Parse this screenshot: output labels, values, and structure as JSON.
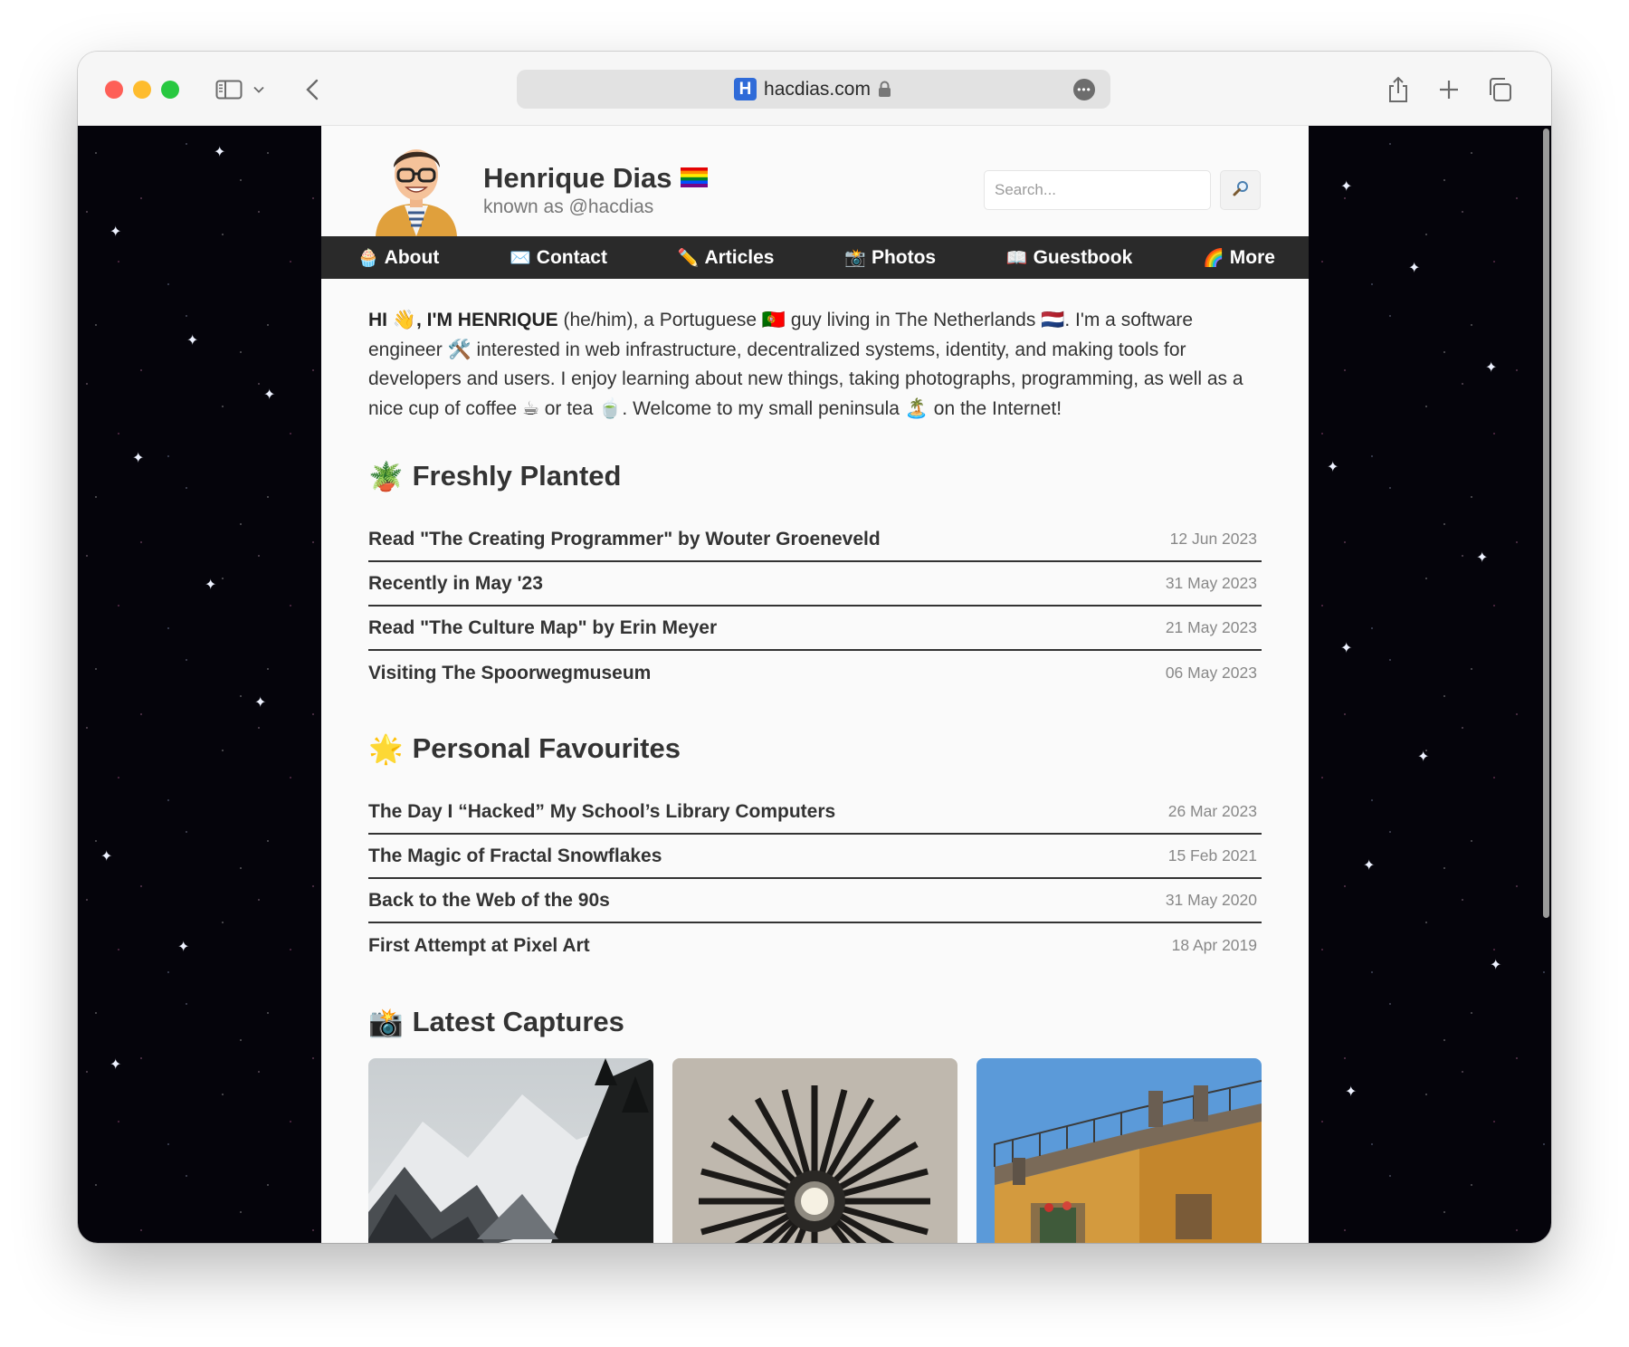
{
  "browser": {
    "url": "hacdias.com",
    "favicon_letter": "H"
  },
  "site": {
    "name": "Henrique Dias",
    "name_flag": "🏳️‍🌈",
    "subtitle": "known as @hacdias"
  },
  "search": {
    "placeholder": "Search...",
    "button_icon": "magnifier-icon"
  },
  "nav": [
    {
      "emoji": "🧁",
      "label": "About"
    },
    {
      "emoji": "✉️",
      "label": "Contact"
    },
    {
      "emoji": "✏️",
      "label": "Articles"
    },
    {
      "emoji": "📸",
      "label": "Photos"
    },
    {
      "emoji": "📖",
      "label": "Guestbook"
    },
    {
      "emoji": "🌈",
      "label": "More"
    }
  ],
  "intro": {
    "greeting": "HI 👋, I'M HENRIQUE",
    "text": " (he/him), a Portuguese 🇵🇹 guy living in The Netherlands 🇳🇱. I'm a software engineer 🛠️ interested in web infrastructure, decentralized systems, identity, and making tools for developers and users. I enjoy learning about new things, taking photographs, programming, as well as a nice cup of coffee ☕ or tea 🍵. Welcome to my small peninsula 🏝️ on the Internet!"
  },
  "sections": {
    "freshly_planted": {
      "emoji": "🪴",
      "title": "Freshly Planted",
      "posts": [
        {
          "title": "Read \"The Creating Programmer\" by Wouter Groeneveld",
          "date": "12 Jun 2023"
        },
        {
          "title": "Recently in May '23",
          "date": "31 May 2023"
        },
        {
          "title": "Read \"The Culture Map\" by Erin Meyer",
          "date": "21 May 2023"
        },
        {
          "title": "Visiting The Spoorwegmuseum",
          "date": "06 May 2023"
        }
      ]
    },
    "personal_favourites": {
      "emoji": "🌟",
      "title": "Personal Favourites",
      "posts": [
        {
          "title": "The Day I “Hacked” My School’s Library Computers",
          "date": "26 Mar 2023"
        },
        {
          "title": "The Magic of Fractal Snowflakes",
          "date": "15 Feb 2021"
        },
        {
          "title": "Back to the Web of the 90s",
          "date": "31 May 2020"
        },
        {
          "title": "First Attempt at Pixel Art",
          "date": "18 Apr 2019"
        }
      ]
    },
    "latest_captures": {
      "emoji": "📸",
      "title": "Latest Captures"
    }
  }
}
